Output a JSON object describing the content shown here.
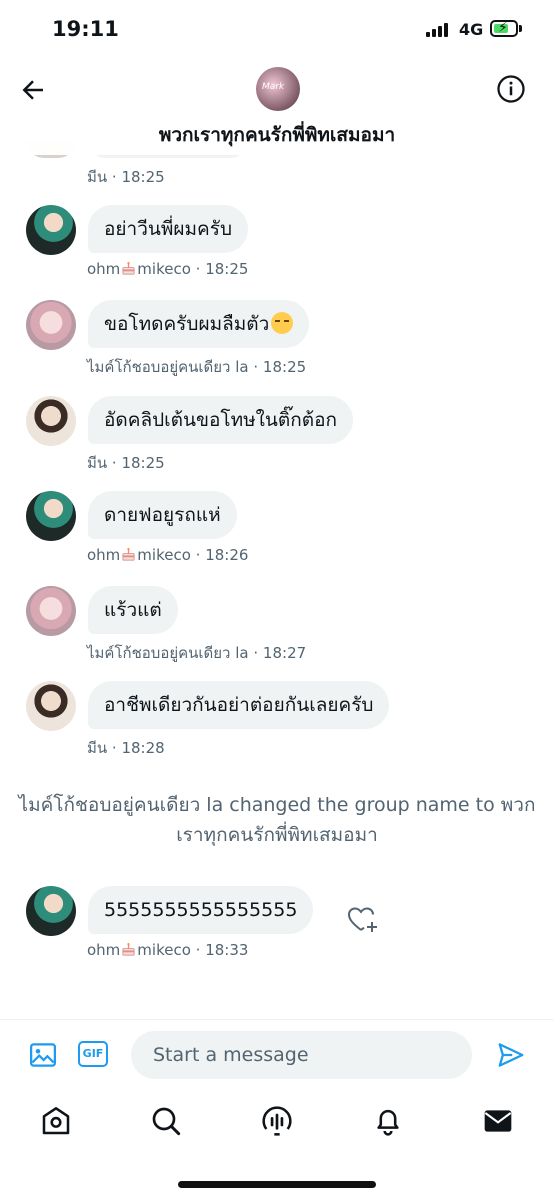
{
  "status_bar": {
    "time": "19:11",
    "network": "4G"
  },
  "header": {
    "group_avatar_text": "Mark",
    "title": "พวกเราทุกคนรักพี่พิทเสมอมา"
  },
  "partial_message": {
    "sender": "มีน",
    "time": "18:25"
  },
  "messages": [
    {
      "text": "อย่าวีนพี่ผมครับ",
      "sender": "ohm",
      "sender_suffix": "mikeco",
      "time": "18:25",
      "avatar": "green"
    },
    {
      "text": "ขอโทดครับผมลืมตัว",
      "emoji": "disappointed-face",
      "sender": "ไมค์โก้ชอบอยู่คนเดียว la",
      "time": "18:25",
      "avatar": "pink"
    },
    {
      "text": "อัดคลิปเต้นขอโทษในติ๊กต้อก",
      "sender": "มีน",
      "time": "18:25",
      "avatar": "beige"
    },
    {
      "text": "ดายฟอยูรถแห่",
      "sender": "ohm",
      "sender_suffix": "mikeco",
      "time": "18:26",
      "avatar": "green"
    },
    {
      "text": "แร้วแต่",
      "sender": "ไมค์โก้ชอบอยู่คนเดียว la",
      "time": "18:27",
      "avatar": "pink"
    },
    {
      "text": "อาชีพเดียวกันอย่าต่อยกันเลยครับ",
      "sender": "มีน",
      "time": "18:28",
      "avatar": "beige"
    },
    {
      "text": "5555555555555555",
      "sender": "ohm",
      "sender_suffix": "mikeco",
      "time": "18:33",
      "avatar": "green"
    }
  ],
  "system_message": {
    "line1": "ไมค์โก้ชอบอยู่คนเดียว la changed the group name to พวก",
    "line2": "เราทุกคนรักพี่พิทเสมอมา"
  },
  "composer": {
    "placeholder": "Start a message",
    "gif_label": "GIF"
  },
  "icons": {
    "back": "arrow-left-icon",
    "info": "info-icon",
    "media": "image-icon",
    "gif": "gif-icon",
    "send": "send-icon",
    "react": "heart-plus-icon",
    "home": "home-icon",
    "search": "search-icon",
    "spaces": "microphone-icon",
    "notifications": "bell-icon",
    "messages": "envelope-icon"
  },
  "colors": {
    "accent": "#1d9bf0",
    "bubble": "#eff3f4",
    "meta_text": "#536471"
  }
}
